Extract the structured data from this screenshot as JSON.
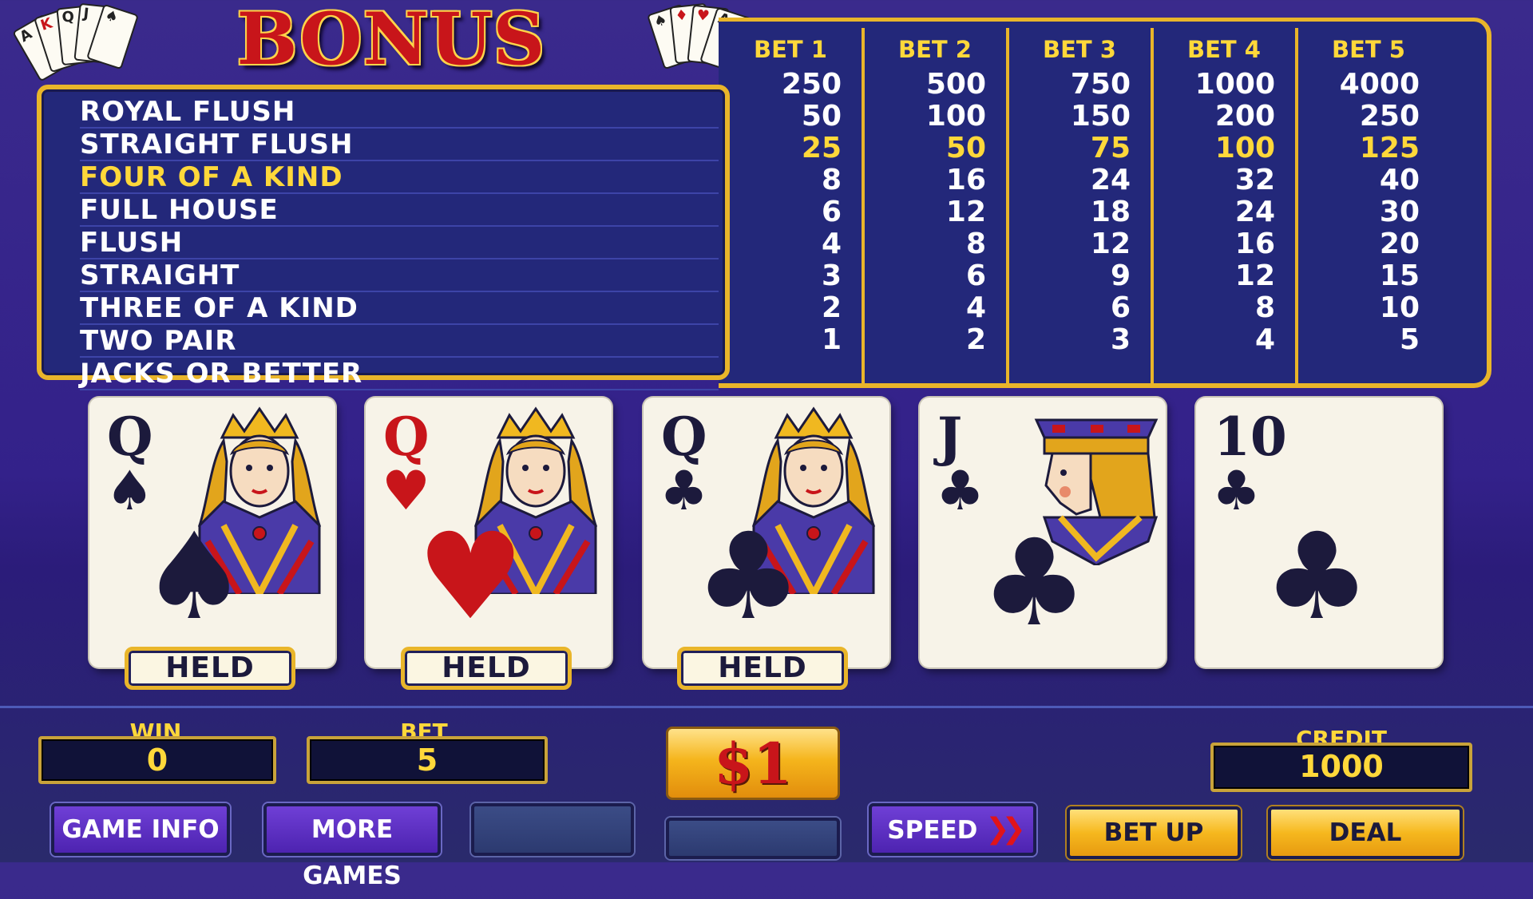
{
  "title": "BONUS POKER",
  "paytable": {
    "hands": [
      "ROYAL FLUSH",
      "STRAIGHT FLUSH",
      "FOUR OF A KIND",
      "FULL HOUSE",
      "FLUSH",
      "STRAIGHT",
      "THREE OF A KIND",
      "TWO PAIR",
      "JACKS OR BETTER"
    ],
    "highlighted_index": 2,
    "columns": [
      {
        "header": "BET 1",
        "values": [
          "250",
          "50",
          "25",
          "8",
          "6",
          "4",
          "3",
          "2",
          "1"
        ]
      },
      {
        "header": "BET 2",
        "values": [
          "500",
          "100",
          "50",
          "16",
          "12",
          "8",
          "6",
          "4",
          "2"
        ]
      },
      {
        "header": "BET 3",
        "values": [
          "750",
          "150",
          "75",
          "24",
          "18",
          "12",
          "9",
          "6",
          "3"
        ]
      },
      {
        "header": "BET 4",
        "values": [
          "1000",
          "200",
          "100",
          "32",
          "24",
          "16",
          "12",
          "8",
          "4"
        ]
      },
      {
        "header": "BET 5",
        "values": [
          "4000",
          "250",
          "125",
          "40",
          "30",
          "20",
          "15",
          "10",
          "5"
        ]
      }
    ]
  },
  "cards": [
    {
      "rank": "Q",
      "suit": "♠",
      "color": "black",
      "face": "queen",
      "held": true
    },
    {
      "rank": "Q",
      "suit": "♥",
      "color": "red",
      "face": "queen",
      "held": true
    },
    {
      "rank": "Q",
      "suit": "♣",
      "color": "black",
      "face": "queen",
      "held": true
    },
    {
      "rank": "J",
      "suit": "♣",
      "color": "black",
      "face": "jack",
      "held": false
    },
    {
      "rank": "10",
      "suit": "♣",
      "color": "black",
      "face": "none",
      "held": false
    }
  ],
  "held_label": "HELD",
  "meters": {
    "win": {
      "label": "WIN",
      "value": "0"
    },
    "bet": {
      "label": "BET",
      "value": "5"
    },
    "credit": {
      "label": "CREDIT",
      "value": "1000"
    },
    "denomination": "$1"
  },
  "buttons": {
    "game_info": "GAME INFO",
    "more_games": "MORE GAMES",
    "speed": "SPEED",
    "bet_up": "BET UP",
    "deal": "DEAL"
  },
  "colors": {
    "background": "#33218a",
    "panel": "#23287a",
    "gold": "#e9b52a",
    "highlight_text": "#ffd83a",
    "red": "#c8151a"
  }
}
